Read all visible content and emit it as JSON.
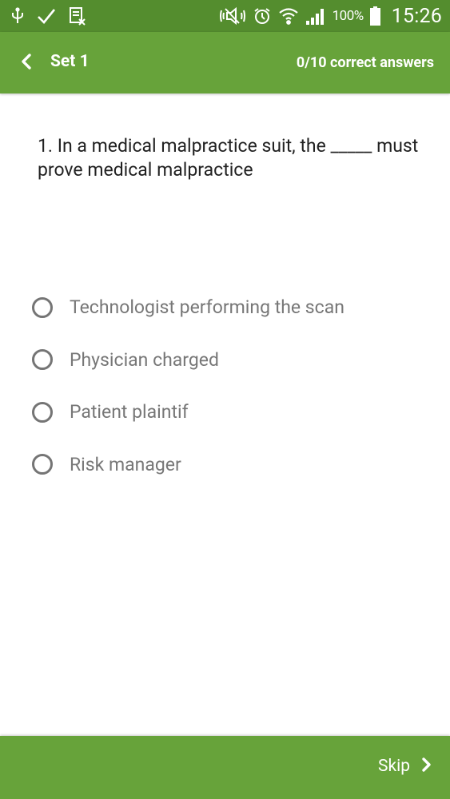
{
  "status_bar": {
    "icons": [
      "usb-icon",
      "check-icon",
      "screenshot-icon",
      "mute-icon",
      "alarm-icon",
      "wifi-icon",
      "signal-icon",
      "battery-icon"
    ],
    "battery": "100%",
    "time": "15:26"
  },
  "header": {
    "back_icon": "chevron-left-icon",
    "title": "Set 1",
    "score": "0/10 correct answers"
  },
  "question": {
    "text": "1. In a medical malpractice suit, the _____ must prove medical malpractice"
  },
  "options": [
    {
      "label": "Technologist performing the scan",
      "selected": false
    },
    {
      "label": "Physician charged",
      "selected": false
    },
    {
      "label": "Patient plaintif",
      "selected": false
    },
    {
      "label": "Risk manager",
      "selected": false
    }
  ],
  "footer": {
    "skip_label": "Skip",
    "skip_icon": "chevron-right-icon"
  },
  "colors": {
    "status_bar": "#548d2e",
    "app_bar": "#67a33a",
    "radio": "#757575",
    "option_text": "#777777"
  }
}
